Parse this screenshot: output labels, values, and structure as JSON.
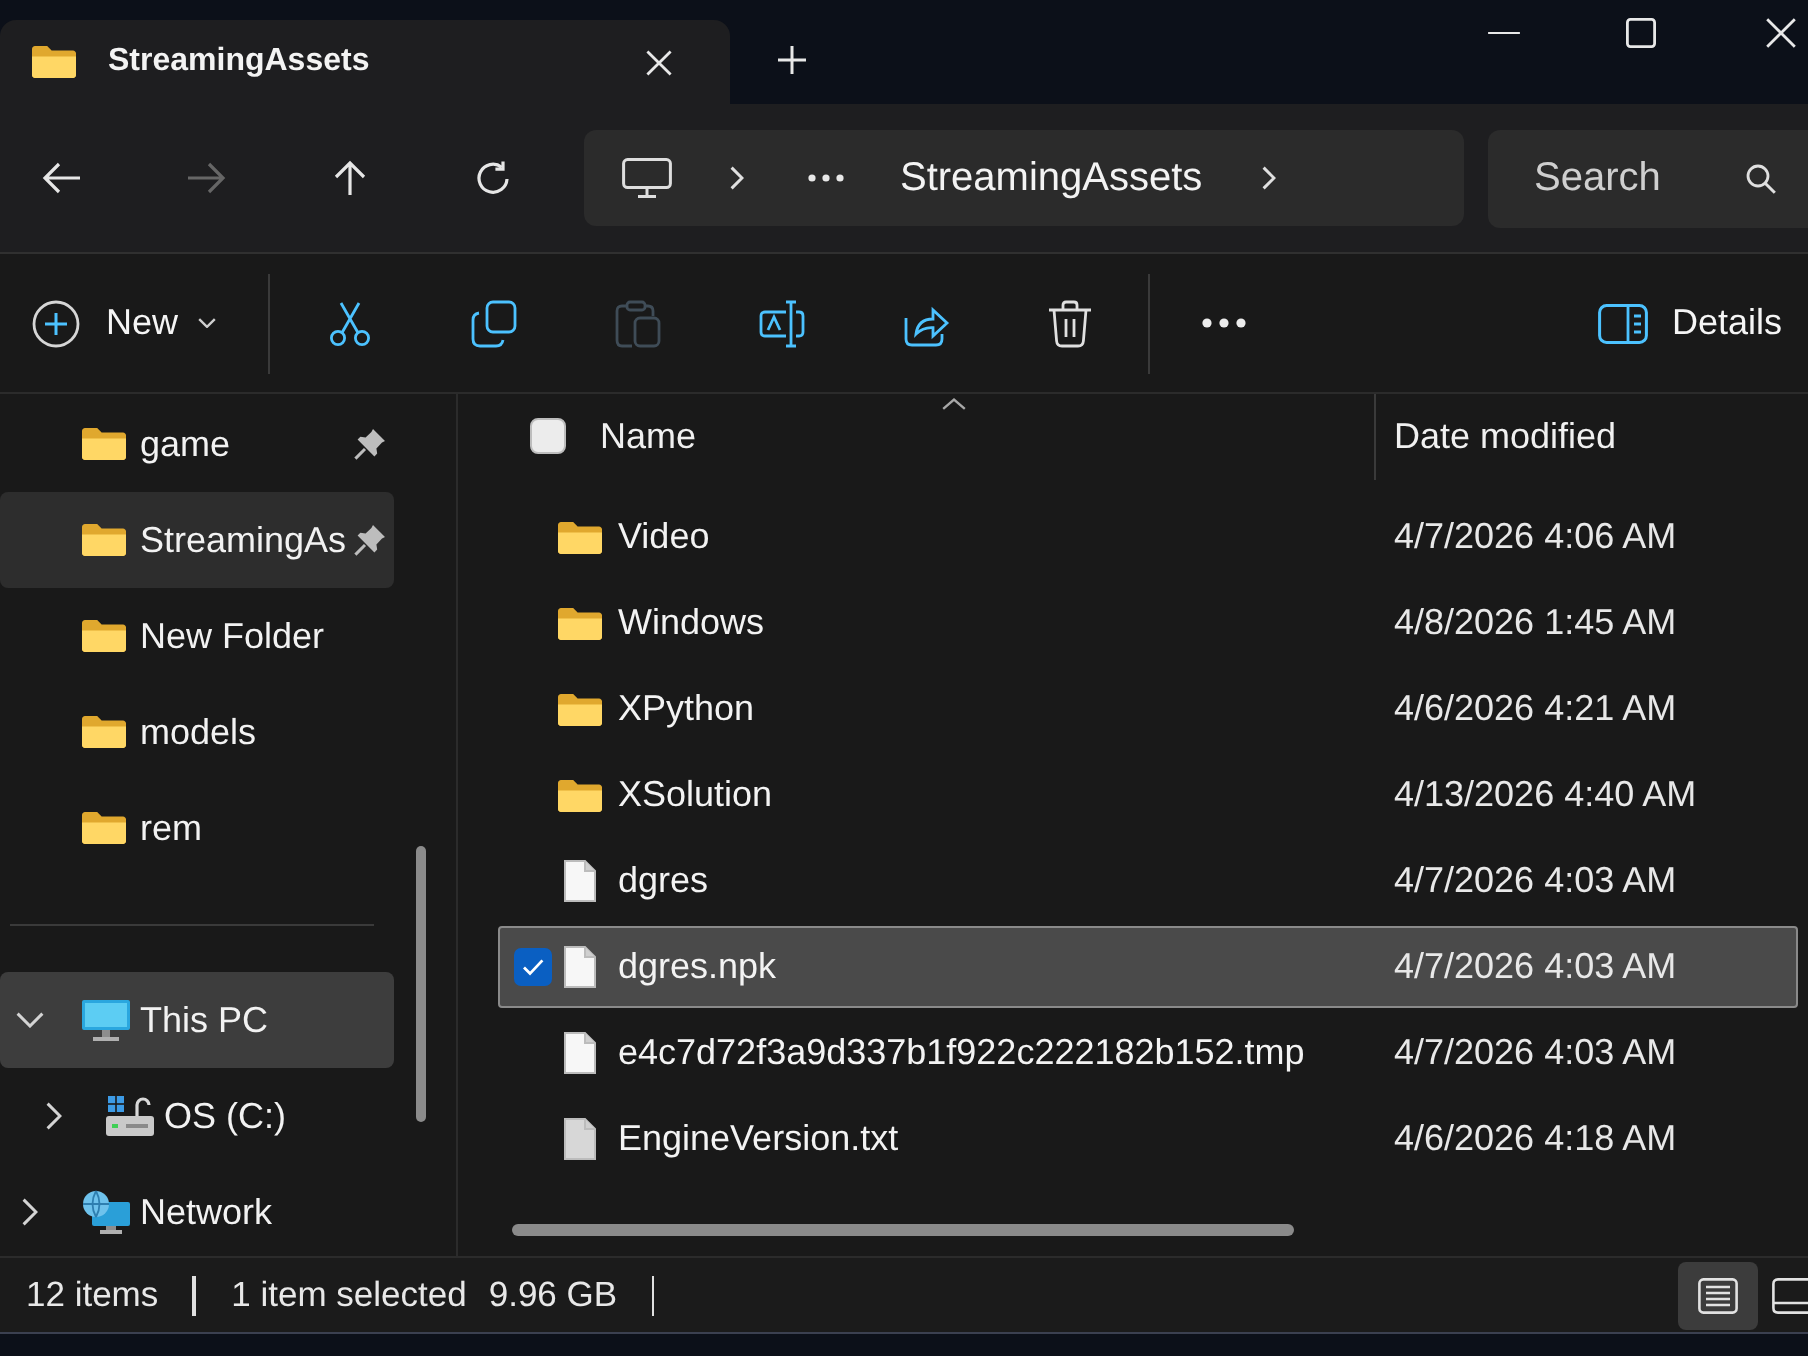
{
  "tabs": [
    {
      "label": "StreamingAssets",
      "selected": true
    }
  ],
  "navigation": [
    {
      "kind": "back",
      "disabled": false
    },
    {
      "kind": "forward",
      "disabled": true
    },
    {
      "kind": "up",
      "disabled": false
    },
    {
      "kind": "refresh",
      "disabled": false
    }
  ],
  "address_bar": {
    "location": "StreamingAssets"
  },
  "search": {
    "placeholder": "Search"
  },
  "toolbar": {
    "new_button": {
      "label": "New"
    },
    "actions": [
      {
        "kind": "cut",
        "disabled": false
      },
      {
        "kind": "copy",
        "disabled": false
      },
      {
        "kind": "paste",
        "disabled": true
      },
      {
        "kind": "rename",
        "disabled": false
      },
      {
        "kind": "share",
        "disabled": false
      },
      {
        "kind": "delete",
        "disabled": false
      }
    ],
    "details_button": {
      "label": "Details"
    }
  },
  "sidebar": {
    "quick_access": [
      {
        "label": "game",
        "pinned": true,
        "selected": false
      },
      {
        "label": "StreamingAs",
        "pinned": true,
        "selected": true
      },
      {
        "label": "New Folder",
        "pinned": false,
        "selected": false
      },
      {
        "label": "models",
        "pinned": false,
        "selected": false
      },
      {
        "label": "rem",
        "pinned": false,
        "selected": false
      }
    ],
    "tree": [
      {
        "label": "This PC",
        "kind": "pc",
        "expanded": true,
        "hovered": true,
        "children": [
          {
            "label": "OS (C:)",
            "kind": "drive",
            "expanded": false,
            "hovered": false
          }
        ]
      },
      {
        "label": "Network",
        "kind": "network",
        "expanded": false,
        "hovered": false
      }
    ]
  },
  "file_list": {
    "select_all": {
      "checked": false
    },
    "columns": [
      {
        "label": "Name",
        "sorted": true
      },
      {
        "label": "Date modified",
        "sorted": false
      }
    ],
    "rows": [
      {
        "name": "Video",
        "kind": "folder",
        "date_modified": "4/7/2026 4:06 AM",
        "selected": false
      },
      {
        "name": "Windows",
        "kind": "folder",
        "date_modified": "4/8/2026 1:45 AM",
        "selected": false
      },
      {
        "name": "XPython",
        "kind": "folder",
        "date_modified": "4/6/2026 4:21 AM",
        "selected": false
      },
      {
        "name": "XSolution",
        "kind": "folder",
        "date_modified": "4/13/2026 4:40 AM",
        "selected": false
      },
      {
        "name": "dgres",
        "kind": "file",
        "date_modified": "4/7/2026 4:03 AM",
        "selected": false
      },
      {
        "name": "dgres.npk",
        "kind": "file",
        "date_modified": "4/7/2026 4:03 AM",
        "selected": true
      },
      {
        "name": "e4c7d72f3a9d337b1f922c222182b152.tmp",
        "kind": "file",
        "date_modified": "4/7/2026 4:03 AM",
        "selected": false
      },
      {
        "name": "EngineVersion.txt",
        "kind": "text",
        "date_modified": "4/6/2026 4:18 AM",
        "selected": false
      }
    ]
  },
  "status_bar": {
    "item_count": "12 items",
    "selection": "1 item selected",
    "selection_size": "9.96 GB",
    "views": [
      {
        "kind": "details",
        "selected": true
      },
      {
        "kind": "tiles",
        "selected": false
      }
    ]
  }
}
